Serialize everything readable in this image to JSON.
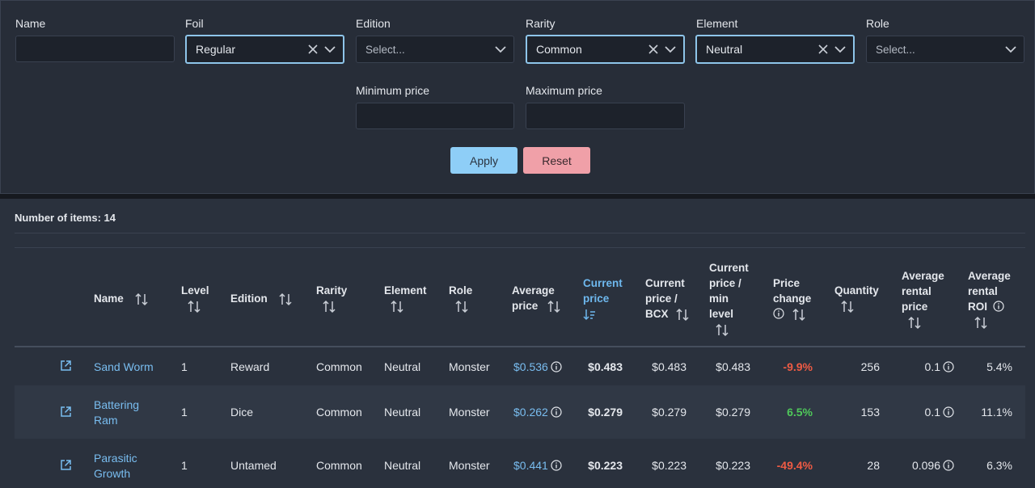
{
  "filters": {
    "name": {
      "label": "Name",
      "value": ""
    },
    "foil": {
      "label": "Foil",
      "value": "Regular"
    },
    "edition": {
      "label": "Edition",
      "placeholder": "Select..."
    },
    "rarity": {
      "label": "Rarity",
      "value": "Common"
    },
    "element": {
      "label": "Element",
      "value": "Neutral"
    },
    "role": {
      "label": "Role",
      "placeholder": "Select..."
    },
    "min_price": {
      "label": "Minimum price",
      "value": ""
    },
    "max_price": {
      "label": "Maximum price",
      "value": ""
    },
    "apply_label": "Apply",
    "reset_label": "Reset"
  },
  "results": {
    "count_text": "Number of items: 14",
    "headers": {
      "name": "Name",
      "level": "Level",
      "edition": "Edition",
      "rarity": "Rarity",
      "element": "Element",
      "role": "Role",
      "avg_price_1": "Average",
      "avg_price_2": "price",
      "current_price_1": "Current",
      "current_price_2": "price",
      "bcx_1": "Current",
      "bcx_2": "price /",
      "bcx_3": "BCX",
      "minlvl_1": "Current",
      "minlvl_2": "price /",
      "minlvl_3": "min",
      "minlvl_4": "level",
      "change_1": "Price",
      "change_2": "change",
      "quantity": "Quantity",
      "rental_1": "Average",
      "rental_2": "rental",
      "rental_3": "price",
      "roi_1": "Average",
      "roi_2": "rental",
      "roi_3": "ROI"
    },
    "rows": [
      {
        "name": "Sand Worm",
        "level": "1",
        "edition": "Reward",
        "rarity": "Common",
        "element": "Neutral",
        "role": "Monster",
        "avg_price": "$0.536",
        "current_price": "$0.483",
        "price_bcx": "$0.483",
        "price_min_level": "$0.483",
        "price_change": "-9.9%",
        "quantity": "256",
        "rental_price": "0.1",
        "rental_roi": "5.4%"
      },
      {
        "name_1": "Battering",
        "name_2": "Ram",
        "level": "1",
        "edition": "Dice",
        "rarity": "Common",
        "element": "Neutral",
        "role": "Monster",
        "avg_price": "$0.262",
        "current_price": "$0.279",
        "price_bcx": "$0.279",
        "price_min_level": "$0.279",
        "price_change": "6.5%",
        "quantity": "153",
        "rental_price": "0.1",
        "rental_roi": "11.1%"
      },
      {
        "name_1": "Parasitic",
        "name_2": "Growth",
        "level": "1",
        "edition": "Untamed",
        "rarity": "Common",
        "element": "Neutral",
        "role": "Monster",
        "avg_price": "$0.441",
        "current_price": "$0.223",
        "price_bcx": "$0.223",
        "price_min_level": "$0.223",
        "price_change": "-49.4%",
        "quantity": "28",
        "rental_price": "0.096",
        "rental_roi": "6.3%"
      }
    ]
  },
  "colors": {
    "accent": "#8ecef7",
    "link": "#79bdf0",
    "negative": "#ef5b44",
    "positive": "#4fc85a",
    "reset": "#f0a0a8"
  }
}
